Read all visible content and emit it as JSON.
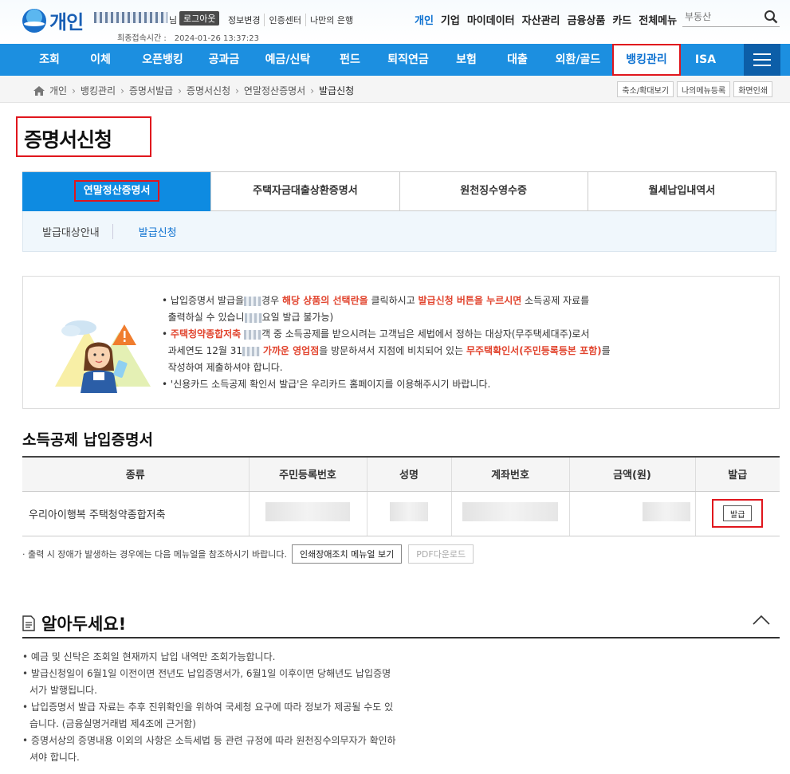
{
  "header": {
    "logo_text": "개인",
    "honorific": "님",
    "logout_label": "로그아웃",
    "util_links": [
      "정보변경",
      "인증센터",
      "나만의 은행"
    ],
    "last_login_label": "최종접속시간 :",
    "last_login_value": "2024-01-26 13:37:23",
    "gnb": [
      "개인",
      "기업",
      "마이데이터",
      "자산관리",
      "금융상품",
      "카드",
      "전체메뉴"
    ],
    "search_placeholder": "부동산"
  },
  "main_nav": {
    "items": [
      "조회",
      "이체",
      "오픈뱅킹",
      "공과금",
      "예금/신탁",
      "펀드",
      "퇴직연금",
      "보험",
      "대출",
      "외환/골드",
      "뱅킹관리",
      "ISA"
    ],
    "active": "뱅킹관리"
  },
  "breadcrumb": {
    "items": [
      "개인",
      "뱅킹관리",
      "증명서발급",
      "증명서신청",
      "연말정산증명서",
      "발급신청"
    ],
    "tools": [
      "축소/확대보기",
      "나의메뉴등록",
      "화면인쇄"
    ]
  },
  "page_title": "증명서신청",
  "tabs": {
    "items": [
      "연말정산증명서",
      "주택자금대출상환증명서",
      "원천징수영수증",
      "월세납입내역서"
    ],
    "active": "연말정산증명서",
    "subtabs": [
      "발급대상안내",
      "발급신청"
    ]
  },
  "notice": {
    "l1a": "납입증명서 발급을",
    "l1b": "경우 ",
    "l1c": "해당 상품의 선택란을",
    "l1d": " 클릭하시고 ",
    "l1e": "발급신청 버튼을 누르시면",
    "l1f": " 소득공제 자료를",
    "l2a": "출력하실 수 있습니",
    "l2b": "요일 발급 불가능)",
    "l3a": "주택청약종합저축",
    "l3b": "객 중 소득공제를 받으시려는 고객님은 세법에서 정하는 대상자(무주택세대주)로서",
    "l4a": "과세연도 12월 31",
    "l4b": " ",
    "l4c": "가까운 영업점",
    "l4d": "을 방문하셔서 지점에 비치되어 있는 ",
    "l4e": "무주택확인서(주민등록등본 포함)",
    "l4f": "를",
    "l5": "작성하여 제출하셔야 합니다.",
    "l6": "'신용카드 소득공제 확인서 발급'은 우리카드 홈페이지를 이용해주시기 바랍니다."
  },
  "section_title": "소득공제 납입증명서",
  "table": {
    "headers": [
      "종류",
      "주민등록번호",
      "성명",
      "계좌번호",
      "금액(원)",
      "발급"
    ],
    "rows": [
      {
        "product": "우리아이행복 주택청약종합저축",
        "issue_label": "발급"
      }
    ]
  },
  "footnote": {
    "text": "출력 시 장애가 발생하는 경우에는 다음 메뉴얼을 참조하시기 바랍니다.",
    "manual_btn": "인쇄장애조치 메뉴얼 보기",
    "pdf_btn": "PDF다운로드"
  },
  "know": {
    "title": "알아두세요!",
    "items": [
      "예금 및 신탁은 조회일 현재까지 납입 내역만 조회가능합니다.",
      "발급신청일이 6월1일 이전이면 전년도 납입증명서가, 6월1일 이후이면 당해년도 납입증명서가 발행됩니다.",
      "납입증명서 발급 자료는 추후 진위확인을 위하여 국세청 요구에 따라 정보가 제공될 수도 있습니다. (금융실명거래법 제4조에 근거함)",
      "증명서상의 증명내용 이외의 사항은 소득세법 등 관련 규정에 따라 원천징수의무자가 확인하셔야 합니다."
    ]
  },
  "colors": {
    "brand_blue": "#1c8fe0",
    "highlight_red": "#e0161d",
    "active_tab": "#0e8be1",
    "notice_red": "#e1432d"
  }
}
